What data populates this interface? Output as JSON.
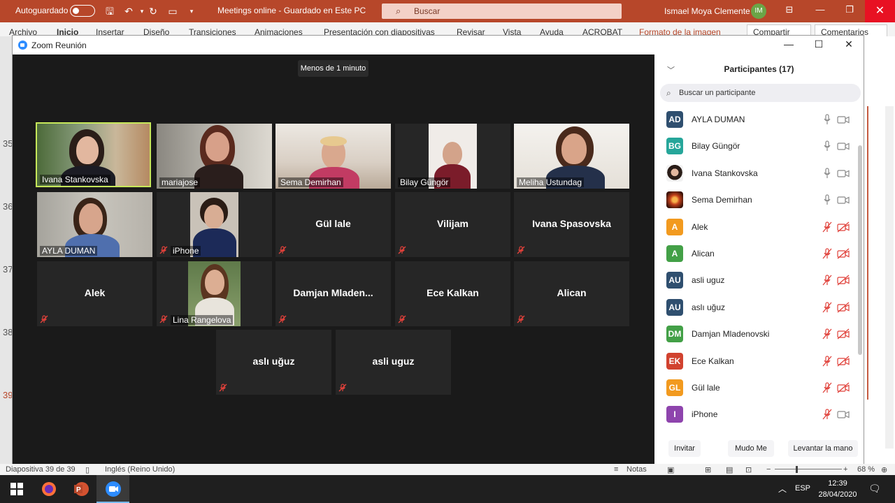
{
  "ppt": {
    "autosave_label": "Autoguardado",
    "doc_title": "Meetings online  -  Guardado en Este PC",
    "search_placeholder": "Buscar",
    "user_name": "Ismael Moya Clemente",
    "user_initials": "IM",
    "ribbon_tabs": [
      "Archivo",
      "Inicio",
      "Insertar",
      "Diseño",
      "Transiciones",
      "Animaciones",
      "Presentación con diapositivas",
      "Revisar",
      "Vista",
      "Ayuda",
      "ACROBAT",
      "Formato de la imagen"
    ],
    "share_label": "Compartir",
    "comments_label": "Comentarios",
    "slide_numbers": [
      "35",
      "36",
      "37",
      "38",
      "39"
    ],
    "status_slide": "Diapositiva 39 de 39",
    "status_lang": "Inglés (Reino Unido)",
    "status_notes": "Notas",
    "zoom_level": "68 %"
  },
  "zoom": {
    "window_title": "Zoom Reunión",
    "timer": "Menos de 1 minuto",
    "tiles": [
      {
        "name": "Ivana Stankovska",
        "video": true,
        "muted": false,
        "active": true
      },
      {
        "name": "mariajose",
        "video": true,
        "muted": false
      },
      {
        "name": "Sema Demirhan",
        "video": true,
        "muted": false
      },
      {
        "name": "Bilay Güngör",
        "video": true,
        "muted": false
      },
      {
        "name": "Meliha Ustundag",
        "video": true,
        "muted": false
      },
      {
        "name": "AYLA DUMAN",
        "video": true,
        "muted": false
      },
      {
        "name": "iPhone",
        "video": true,
        "muted": true
      },
      {
        "name": "Gül lale",
        "video": false,
        "muted": true
      },
      {
        "name": "Vilijam",
        "video": false,
        "muted": true
      },
      {
        "name": "Ivana Spasovska",
        "video": false,
        "muted": true
      },
      {
        "name": "Alek",
        "video": false,
        "muted": true
      },
      {
        "name": "Lina Rangelova",
        "video": true,
        "muted": true
      },
      {
        "name": "Damjan  Mladen...",
        "video": false,
        "muted": true
      },
      {
        "name": "Ece Kalkan",
        "video": false,
        "muted": true
      },
      {
        "name": "Alican",
        "video": false,
        "muted": true
      },
      {
        "name": "aslı uğuz",
        "video": false,
        "muted": true
      },
      {
        "name": "asli uguz",
        "video": false,
        "muted": true
      }
    ],
    "participants": {
      "title": "Participantes (17)",
      "search_placeholder": "Buscar un participante",
      "list": [
        {
          "initials": "AD",
          "name": "AYLA DUMAN",
          "color": "#2f4f6f",
          "mic": "on",
          "cam": "on"
        },
        {
          "initials": "BG",
          "name": "Bilay Güngör",
          "color": "#26a69a",
          "mic": "on",
          "cam": "on"
        },
        {
          "initials": "",
          "name": "Ivana Stankovska",
          "color": "#e0e0e0",
          "mic": "on",
          "cam": "on",
          "photo": true
        },
        {
          "initials": "",
          "name": "Sema Demirhan",
          "color": "#b33a1a",
          "mic": "on",
          "cam": "on",
          "photo": true
        },
        {
          "initials": "A",
          "name": "Alek",
          "color": "#f29a1f",
          "mic": "off",
          "cam": "off"
        },
        {
          "initials": "A",
          "name": "Alican",
          "color": "#43a047",
          "mic": "off",
          "cam": "off"
        },
        {
          "initials": "AU",
          "name": "asli uguz",
          "color": "#2f4f6f",
          "mic": "off",
          "cam": "off"
        },
        {
          "initials": "AU",
          "name": "aslı uğuz",
          "color": "#2f4f6f",
          "mic": "off",
          "cam": "off"
        },
        {
          "initials": "DM",
          "name": "Damjan Mladenovski",
          "color": "#43a047",
          "mic": "off",
          "cam": "off"
        },
        {
          "initials": "EK",
          "name": "Ece Kalkan",
          "color": "#d1422f",
          "mic": "off",
          "cam": "off"
        },
        {
          "initials": "GL",
          "name": "Gül lale",
          "color": "#f29a1f",
          "mic": "off",
          "cam": "off"
        },
        {
          "initials": "I",
          "name": "iPhone",
          "color": "#8e44ad",
          "mic": "off",
          "cam": "on"
        }
      ],
      "buttons": [
        "Invitar",
        "Mudo Me",
        "Levantar la mano"
      ]
    }
  },
  "taskbar": {
    "lang": "ESP",
    "time": "12:39",
    "date": "28/04/2020"
  }
}
